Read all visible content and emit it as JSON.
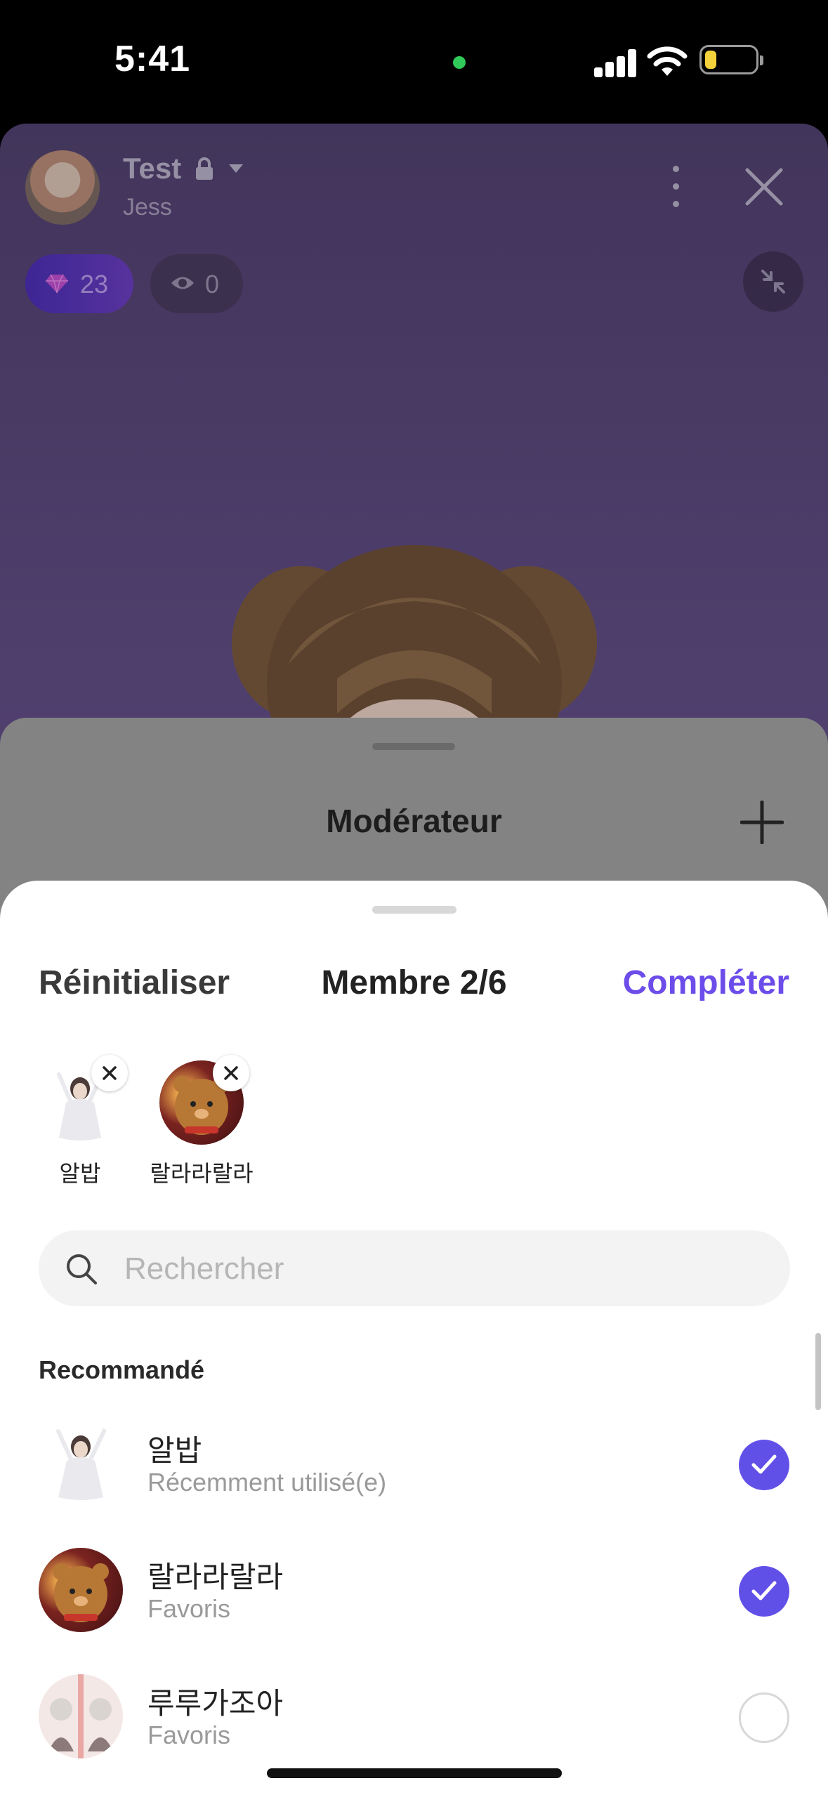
{
  "status_bar": {
    "time": "5:41"
  },
  "room": {
    "title": "Test",
    "host": "Jess",
    "diamonds": "23",
    "viewers": "0"
  },
  "moderator_sheet": {
    "title": "Modérateur"
  },
  "member_sheet": {
    "reset_label": "Réinitialiser",
    "title": "Membre 2/6",
    "complete_label": "Compléter",
    "selected": [
      {
        "name": "알밥"
      },
      {
        "name": "랄라라랄라"
      }
    ],
    "search_placeholder": "Rechercher",
    "section_title": "Recommandé",
    "recommended": [
      {
        "name": "알밥",
        "sub": "Récemment utilisé(e)",
        "checked": true
      },
      {
        "name": "랄라라랄라",
        "sub": "Favoris",
        "checked": true
      },
      {
        "name": "루루가조아",
        "sub": "Favoris",
        "checked": false
      }
    ]
  },
  "colors": {
    "accent": "#6c4dea",
    "check": "#6150e8"
  }
}
